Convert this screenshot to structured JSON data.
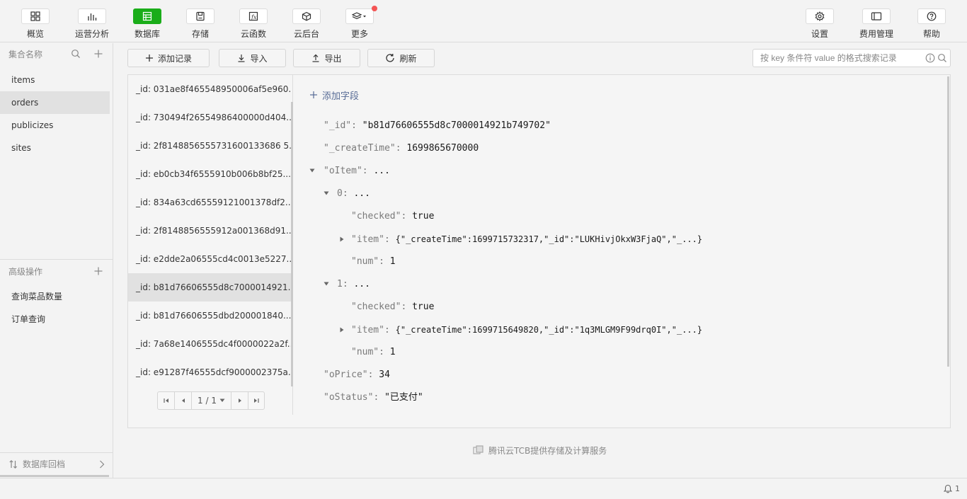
{
  "toolbar": {
    "left": [
      {
        "label": "概览",
        "icon": "overview-icon",
        "active": false
      },
      {
        "label": "运营分析",
        "icon": "analytics-icon",
        "active": false
      },
      {
        "label": "数据库",
        "icon": "database-icon",
        "active": true
      },
      {
        "label": "存储",
        "icon": "storage-icon",
        "active": false
      },
      {
        "label": "云函数",
        "icon": "function-icon",
        "active": false
      },
      {
        "label": "云后台",
        "icon": "cloud-backend-icon",
        "active": false
      },
      {
        "label": "更多",
        "icon": "layers-icon",
        "active": false,
        "badge": true
      }
    ],
    "right": [
      {
        "label": "设置",
        "icon": "gear-icon"
      },
      {
        "label": "费用管理",
        "icon": "billing-icon"
      },
      {
        "label": "帮助",
        "icon": "help-icon"
      }
    ],
    "accent": "#1aad19",
    "badge_color": "#f45454"
  },
  "sidebar": {
    "collections_title": "集合名称",
    "collections": [
      "items",
      "orders",
      "publicizes",
      "sites"
    ],
    "selected_collection": "orders",
    "advanced_title": "高级操作",
    "advanced_items": [
      "查询菜品数量",
      "订单查询"
    ],
    "backup_label": "数据库回档"
  },
  "actions": {
    "add_record": "添加记录",
    "import": "导入",
    "export": "导出",
    "refresh": "刷新",
    "search_placeholder": "按 key 条件符 value 的格式搜索记录"
  },
  "records": [
    "_id: 031ae8f465548950006af5e960...",
    "_id: 730494f26554986400000d404...",
    "_id: 2f8148856555731600133686 5...",
    "_id: eb0cb34f6555910b006b8bf25...",
    "_id: 834a63cd65559121001378df2...",
    "_id: 2f8148856555912a001368d91...",
    "_id: e2dde2a06555cd4c0013e5227...",
    "_id: b81d76606555d8c7000014921...",
    "_id: b81d76606555dbd200001840...",
    "_id: 7a68e1406555dc4f0000022a2f...",
    "_id: e91287f46555dcf9000002375a..."
  ],
  "selected_record_index": 7,
  "pager": {
    "page": "1 / 1"
  },
  "detail": {
    "add_field": "添加字段",
    "id_key": "\"_id\":",
    "id_val": "\"b81d76606555d8c7000014921b749702\"",
    "ct_key": "\"_createTime\":",
    "ct_val": "1699865670000",
    "oitem_key": "\"oItem\":",
    "ellipsis": "...",
    "idx0": "0:",
    "idx1": "1:",
    "checked_key": "\"checked\":",
    "checked_val": "true",
    "item_key": "\"item\":",
    "item0_val": "{\"_createTime\":1699715732317,\"_id\":\"LUKHivjOkxW3FjaQ\",\"_...}",
    "item1_val": "{\"_createTime\":1699715649820,\"_id\":\"1q3MLGM9F99drq0I\",\"_...}",
    "num_key": "\"num\":",
    "num_val": "1",
    "price_key": "\"oPrice\":",
    "price_val": "34",
    "status_key": "\"oStatus\":",
    "status_val": "\"已支付\""
  },
  "footer_note": "腾讯云TCB提供存储及计算服务",
  "status": {
    "notifications": "1"
  }
}
